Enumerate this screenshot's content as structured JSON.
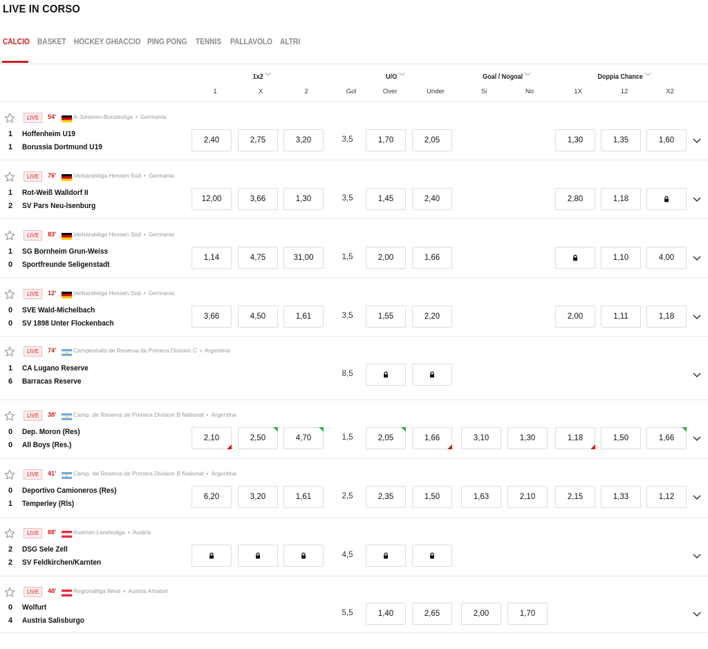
{
  "page": {
    "title": "LIVE IN CORSO"
  },
  "tabs": [
    "CALCIO",
    "BASKET",
    "HOCKEY GHIACCIO",
    "PING PONG",
    "TENNIS",
    "PALLAVOLO",
    "ALTRI"
  ],
  "headers": {
    "groups": [
      "1x2",
      "U/O",
      "Goal / Nogoal",
      "Doppia Chance"
    ],
    "sub": [
      "1",
      "X",
      "2",
      "Gol",
      "Over",
      "Under",
      "Si",
      "No",
      "1X",
      "12",
      "X2"
    ]
  },
  "live_label": "LIVE",
  "colors": {
    "accent": "#d11b1b",
    "up": "#2db34a",
    "down": "#d11b1b"
  },
  "matches": [
    {
      "minute": "54'",
      "flag": "germany",
      "league": "A-Junioren-Bundesliga",
      "country": "Germania",
      "home": "Hoffenheim U19",
      "away": "Borussia Dortmund U19",
      "score_home": "1",
      "score_away": "1",
      "odds": {
        "x1": "2,40",
        "x": "2,75",
        "x2": "3,20",
        "gol": "3,5",
        "over": "1,70",
        "under": "2,05",
        "si": null,
        "no": null,
        "dc1x": "1,30",
        "dc12": "1,35",
        "dcx2": "1,60"
      }
    },
    {
      "minute": "76'",
      "flag": "germany",
      "league": "Verbandsliga Hessen Süd",
      "country": "Germania",
      "home": "Rot-Weiß Walldorf II",
      "away": "SV Pars Neu-Isenburg",
      "score_home": "1",
      "score_away": "2",
      "odds": {
        "x1": "12,00",
        "x": "3,66",
        "x2": "1,30",
        "gol": "3,5",
        "over": "1,45",
        "under": "2,40",
        "si": null,
        "no": null,
        "dc1x": "2,80",
        "dc12": "1,18",
        "dcx2": "lock"
      }
    },
    {
      "minute": "83'",
      "flag": "germany",
      "league": "Verbandsliga Hessen Süd",
      "country": "Germania",
      "home": "SG Bornheim Grun-Weiss",
      "away": "Sportfreunde Seligenstadt",
      "score_home": "1",
      "score_away": "0",
      "odds": {
        "x1": "1,14",
        "x": "4,75",
        "x2": "31,00",
        "gol": "1,5",
        "over": "2,00",
        "under": "1,66",
        "si": null,
        "no": null,
        "dc1x": "lock",
        "dc12": "1,10",
        "dcx2": "4,00"
      }
    },
    {
      "minute": "12'",
      "flag": "germany",
      "league": "Verbandsliga Hessen Süd",
      "country": "Germania",
      "home": "SVE Wald-Michelbach",
      "away": "SV 1898 Unter Flockenbach",
      "score_home": "0",
      "score_away": "0",
      "odds": {
        "x1": "3,66",
        "x": "4,50",
        "x2": "1,61",
        "gol": "3,5",
        "over": "1,55",
        "under": "2,20",
        "si": null,
        "no": null,
        "dc1x": "2,00",
        "dc12": "1,11",
        "dcx2": "1,18"
      }
    },
    {
      "minute": "74'",
      "flag": "argentina",
      "league": "Campeonato de Reserva de Primera Division C",
      "country": "Argentina",
      "home": "CA Lugano Reserve",
      "away": "Barracas Reserve",
      "score_home": "1",
      "score_away": "6",
      "odds": {
        "x1": null,
        "x": null,
        "x2": null,
        "gol": "8,5",
        "over": "lock",
        "under": "lock",
        "si": null,
        "no": null,
        "dc1x": null,
        "dc12": null,
        "dcx2": null
      }
    },
    {
      "minute": "38'",
      "flag": "argentina",
      "league": "Camp. de Reserva de Primera Division B National",
      "country": "Argentina",
      "home": "Dep. Moron (Res)",
      "away": "All Boys (Res.)",
      "score_home": "0",
      "score_away": "0",
      "odds": {
        "x1": "2,10",
        "x": "2,50",
        "x2": "4,70",
        "gol": "1,5",
        "over": "2,05",
        "under": "1,66",
        "si": "3,10",
        "no": "1,30",
        "dc1x": "1,18",
        "dc12": "1,50",
        "dcx2": "1,66"
      },
      "trends": {
        "x1": "down",
        "x": "up",
        "x2": "up",
        "over": "up",
        "under": "down",
        "dc1x": "down",
        "dcx2": "up"
      }
    },
    {
      "minute": "41'",
      "flag": "argentina",
      "league": "Camp. de Reserva de Primera Division B National",
      "country": "Argentina",
      "home": "Deportivo Camioneros (Res)",
      "away": "Temperley (Rls)",
      "score_home": "0",
      "score_away": "1",
      "odds": {
        "x1": "6,20",
        "x": "3,20",
        "x2": "1,61",
        "gol": "2,5",
        "over": "2,35",
        "under": "1,50",
        "si": "1,63",
        "no": "2,10",
        "dc1x": "2,15",
        "dc12": "1,33",
        "dcx2": "1,12"
      }
    },
    {
      "minute": "88'",
      "flag": "austria",
      "league": "Austrian Landesliga",
      "country": "Austria",
      "home": "DSG Sele Zell",
      "away": "SV Feldkirchen/Karnten",
      "score_home": "2",
      "score_away": "2",
      "odds": {
        "x1": "lock",
        "x": "lock",
        "x2": "lock",
        "gol": "4,5",
        "over": "lock",
        "under": "lock",
        "si": null,
        "no": null,
        "dc1x": null,
        "dc12": null,
        "dcx2": null
      }
    },
    {
      "minute": "48'",
      "flag": "austria",
      "league": "Regionalliga West",
      "country": "Austria Amatori",
      "home": "Wolfurt",
      "away": "Austria Salisburgo",
      "score_home": "0",
      "score_away": "4",
      "odds": {
        "x1": null,
        "x": null,
        "x2": null,
        "gol": "5,5",
        "over": "1,40",
        "under": "2,65",
        "si": "2,00",
        "no": "1,70",
        "dc1x": null,
        "dc12": null,
        "dcx2": null
      }
    }
  ]
}
